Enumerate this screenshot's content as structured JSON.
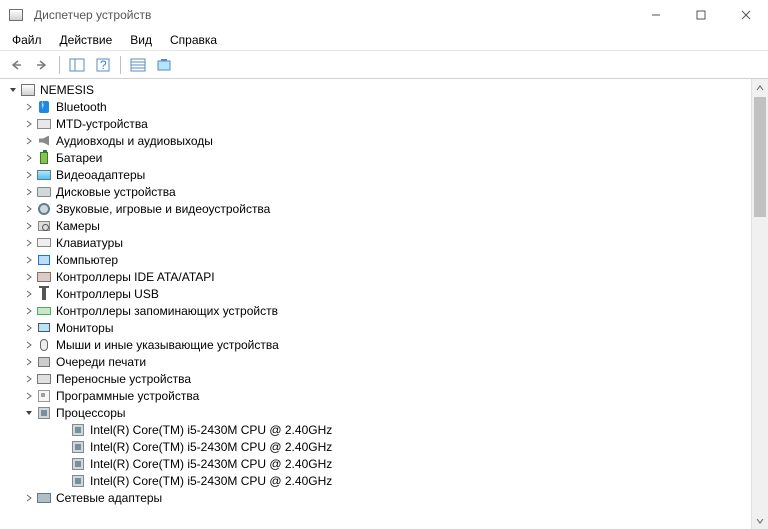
{
  "window": {
    "title": "Диспетчер устройств"
  },
  "menu": {
    "file": "Файл",
    "action": "Действие",
    "view": "Вид",
    "help": "Справка"
  },
  "tree": {
    "root": "NEMESIS",
    "nodes": [
      {
        "label": "Bluetooth",
        "icon": "bt"
      },
      {
        "label": "MTD-устройства",
        "icon": "mtd"
      },
      {
        "label": "Аудиовходы и аудиовыходы",
        "icon": "audio"
      },
      {
        "label": "Батареи",
        "icon": "batt"
      },
      {
        "label": "Видеоадаптеры",
        "icon": "video"
      },
      {
        "label": "Дисковые устройства",
        "icon": "disk"
      },
      {
        "label": "Звуковые, игровые и видеоустройства",
        "icon": "game"
      },
      {
        "label": "Камеры",
        "icon": "cam"
      },
      {
        "label": "Клавиатуры",
        "icon": "kbd"
      },
      {
        "label": "Компьютер",
        "icon": "pc"
      },
      {
        "label": "Контроллеры IDE ATA/ATAPI",
        "icon": "ide"
      },
      {
        "label": "Контроллеры USB",
        "icon": "usb"
      },
      {
        "label": "Контроллеры запоминающих устройств",
        "icon": "mem"
      },
      {
        "label": "Мониторы",
        "icon": "mon"
      },
      {
        "label": "Мыши и иные указывающие устройства",
        "icon": "mouse"
      },
      {
        "label": "Очереди печати",
        "icon": "print"
      },
      {
        "label": "Переносные устройства",
        "icon": "port"
      },
      {
        "label": "Программные устройства",
        "icon": "soft"
      },
      {
        "label": "Процессоры",
        "icon": "cpu",
        "expanded": true
      },
      {
        "label": "Сетевые адаптеры",
        "icon": "net"
      }
    ],
    "cpu_children": [
      "Intel(R) Core(TM) i5-2430M CPU @ 2.40GHz",
      "Intel(R) Core(TM) i5-2430M CPU @ 2.40GHz",
      "Intel(R) Core(TM) i5-2430M CPU @ 2.40GHz",
      "Intel(R) Core(TM) i5-2430M CPU @ 2.40GHz"
    ]
  }
}
